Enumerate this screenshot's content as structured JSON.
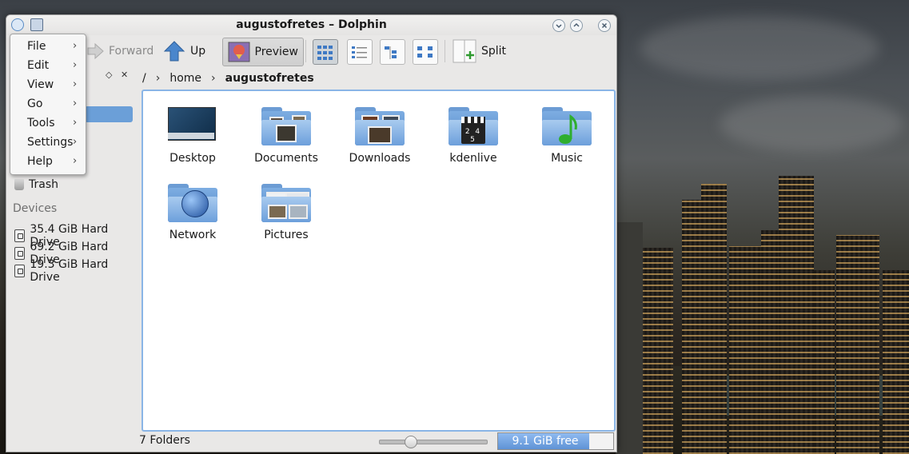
{
  "window": {
    "title": "augustofretes – Dolphin"
  },
  "toolbar": {
    "forward_label": "Forward",
    "up_label": "Up",
    "preview_label": "Preview",
    "split_label": "Split"
  },
  "menu": {
    "items": [
      {
        "label": "File"
      },
      {
        "label": "Edit"
      },
      {
        "label": "View"
      },
      {
        "label": "Go"
      },
      {
        "label": "Tools"
      },
      {
        "label": "Settings"
      },
      {
        "label": "Help"
      }
    ]
  },
  "sidebar": {
    "trash_label": "Trash",
    "devices_heading": "Devices",
    "devices": [
      {
        "label": "35.4 GiB Hard Drive"
      },
      {
        "label": "69.2 GiB Hard Drive"
      },
      {
        "label": "19.3 GiB Hard Drive"
      }
    ]
  },
  "breadcrumb": {
    "root": "/",
    "segments": [
      "home",
      "augustofretes"
    ]
  },
  "files": [
    {
      "name": "Desktop",
      "icon": "desktop-folder-icon"
    },
    {
      "name": "Documents",
      "icon": "documents-folder-icon"
    },
    {
      "name": "Downloads",
      "icon": "downloads-folder-icon"
    },
    {
      "name": "kdenlive",
      "icon": "video-folder-icon"
    },
    {
      "name": "Music",
      "icon": "music-folder-icon"
    },
    {
      "name": "Network",
      "icon": "network-folder-icon"
    },
    {
      "name": "Pictures",
      "icon": "pictures-folder-icon"
    }
  ],
  "statusbar": {
    "summary": "7 Folders",
    "free_space": "9.1 GiB free",
    "used_fraction": 0.79,
    "zoom_level": 0.28
  },
  "colors": {
    "accent": "#6b9fd8",
    "folder": "#7eaee2"
  }
}
